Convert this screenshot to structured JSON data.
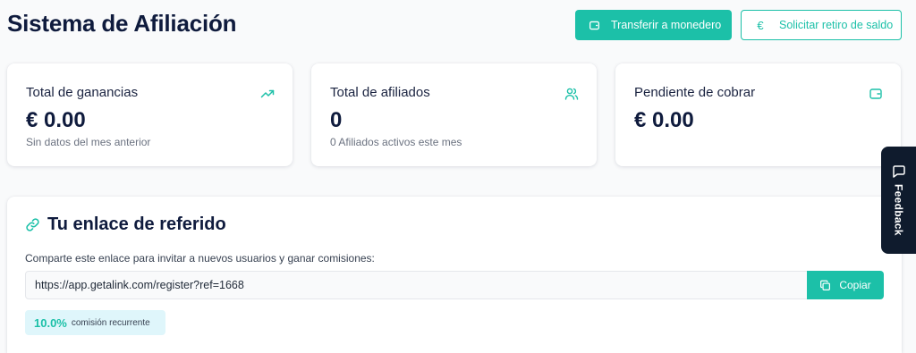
{
  "header": {
    "title": "Sistema de Afiliación",
    "transfer_label": "Transferir a monedero",
    "withdraw_label": "Solicitar retiro de saldo",
    "withdraw_icon": "€"
  },
  "stats": [
    {
      "label": "Total de ganancias",
      "value": "€ 0.00",
      "sub": "Sin datos del mes anterior",
      "icon": "trending-up-icon"
    },
    {
      "label": "Total de afiliados",
      "value": "0",
      "sub": "0 Afiliados activos este mes",
      "icon": "users-icon"
    },
    {
      "label": "Pendiente de cobrar",
      "value": "€ 0.00",
      "sub": "",
      "icon": "wallet-icon"
    }
  ],
  "referral": {
    "title": "Tu enlace de referido",
    "description": "Comparte este enlace para invitar a nuevos usuarios y ganar comisiones:",
    "link": "https://app.getalink.com/register?ref=1668",
    "copy_label": "Copiar",
    "commission_pct": "10.0%",
    "commission_text": "comisión recurrente"
  },
  "feedback": {
    "label": "Feedback"
  },
  "colors": {
    "accent": "#1cc0a8",
    "dark": "#0f1b3d",
    "badge_bg": "#dff6fb"
  }
}
